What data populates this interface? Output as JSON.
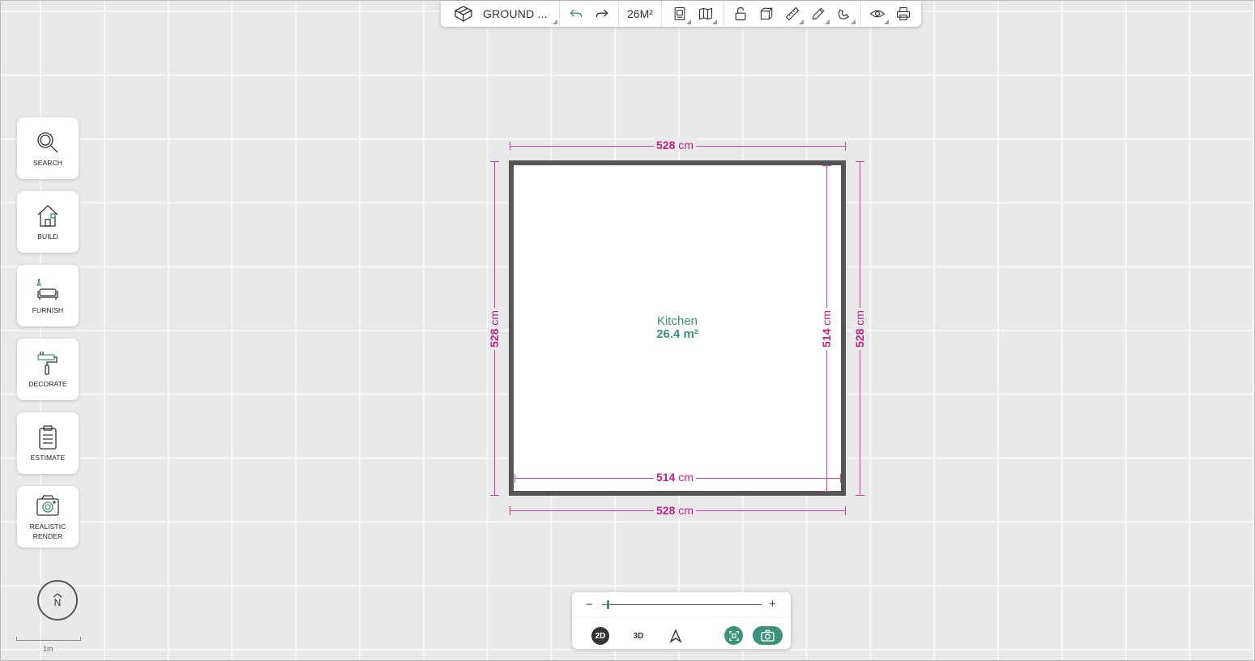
{
  "toolbar": {
    "floor_label": "GROUND ...",
    "area_label": "26M²",
    "icons": [
      "cube-icon",
      "undo-icon",
      "redo-icon",
      "document-icon",
      "map-icon",
      "lock-open-icon",
      "box-3d-icon",
      "ruler-icon",
      "pencil-icon",
      "magnet-icon",
      "eye-icon",
      "print-icon"
    ]
  },
  "sidebar": {
    "items": [
      {
        "label": "SEARCH",
        "icon": "search-icon"
      },
      {
        "label": "BUILD",
        "icon": "house-icon"
      },
      {
        "label": "FURNISH",
        "icon": "sofa-icon"
      },
      {
        "label": "DECORATE",
        "icon": "paint-roller-icon"
      },
      {
        "label": "ESTIMATE",
        "icon": "clipboard-icon"
      },
      {
        "label": "REALISTIC RENDER",
        "icon": "camera-icon"
      }
    ]
  },
  "compass": {
    "label": "N"
  },
  "scale": {
    "label": "1m"
  },
  "room": {
    "name": "Kitchen",
    "area": "26.4 m²"
  },
  "dimensions": {
    "top": {
      "value": "528",
      "unit": "cm"
    },
    "bottom_inner": {
      "value": "514",
      "unit": "cm"
    },
    "bottom_outer": {
      "value": "528",
      "unit": "cm"
    },
    "left": {
      "value": "528",
      "unit": "cm"
    },
    "right_inner": {
      "value": "514",
      "unit": "cm"
    },
    "right_outer": {
      "value": "528",
      "unit": "cm"
    }
  },
  "view_panel": {
    "zoom_minus": "−",
    "zoom_plus": "+",
    "zoom_level": 0.03,
    "mode_2d": "2D",
    "mode_3d": "3D",
    "active_mode": "2D"
  },
  "colors": {
    "accent": "#3b9278",
    "dimension": "#c21f8c",
    "wall": "#555555",
    "canvas": "#e9e9e9"
  }
}
